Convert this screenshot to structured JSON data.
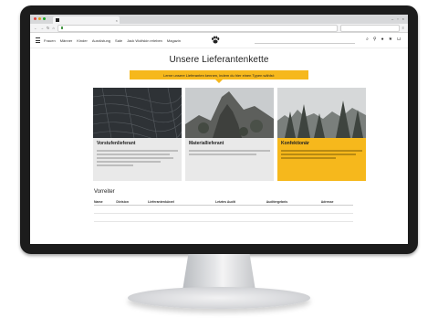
{
  "browser": {
    "tab_title": "",
    "url_secure": "",
    "url_text": "",
    "search_placeholder": ""
  },
  "site": {
    "nav": [
      "Frauen",
      "Männer",
      "Kinder",
      "Ausrüstung",
      "Sale",
      "Jack Wolfskin erleben",
      "Magazin"
    ],
    "search_placeholder": ""
  },
  "page": {
    "title": "Unsere Lieferantenkette",
    "banner": "Lerne unsere Lieferanten kennen, indem du hier einen Typen wählst:"
  },
  "cards": [
    {
      "title": "Vorstufenlieferant",
      "desc": ""
    },
    {
      "title": "Materiallieferant",
      "desc": ""
    },
    {
      "title": "Konfektionär",
      "desc": ""
    }
  ],
  "suppliers": {
    "heading": "Vorreiter",
    "columns": [
      "Name",
      "Division",
      "Lieferantenkürzel",
      "Letztes Audit",
      "Auditergebnis",
      "Adresse"
    ],
    "rows": [
      [
        "",
        "",
        "",
        "",
        "",
        ""
      ],
      [
        "",
        "",
        "",
        "",
        "",
        ""
      ]
    ]
  },
  "colors": {
    "accent": "#f6b81c",
    "bezel": "#1c1c1c",
    "card_bg": "#e9e9e9"
  }
}
